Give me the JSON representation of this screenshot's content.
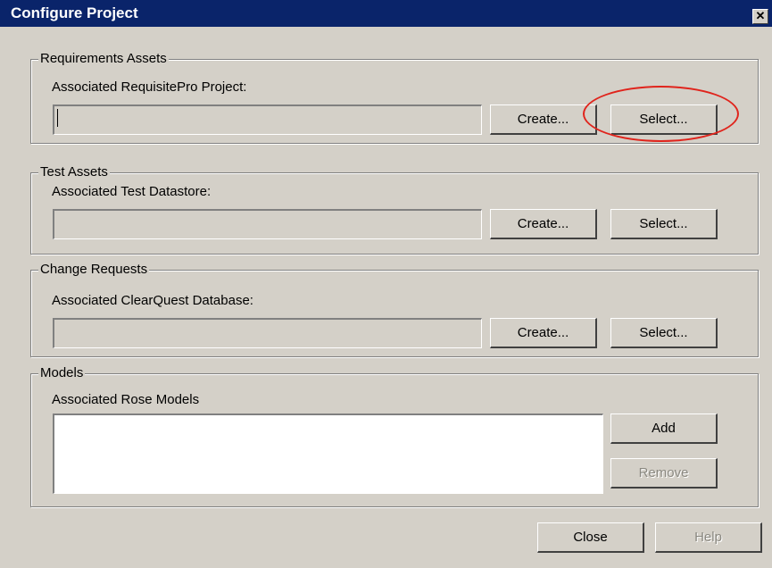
{
  "window": {
    "title": "Configure Project",
    "close_glyph": "✕"
  },
  "groups": {
    "requirements": {
      "title": "Requirements Assets",
      "label": "Associated RequisitePro Project:",
      "value": "",
      "create_label": "Create...",
      "select_label": "Select..."
    },
    "test": {
      "title": "Test Assets",
      "label": "Associated Test Datastore:",
      "value": "",
      "create_label": "Create...",
      "select_label": "Select..."
    },
    "change": {
      "title": "Change Requests",
      "label": "Associated ClearQuest Database:",
      "value": "",
      "create_label": "Create...",
      "select_label": "Select..."
    },
    "models": {
      "title": "Models",
      "label": "Associated Rose Models",
      "items": [],
      "add_label": "Add",
      "remove_label": "Remove"
    }
  },
  "footer": {
    "close_label": "Close",
    "help_label": "Help"
  },
  "colors": {
    "titlebar": "#0a246a",
    "dialog_bg": "#d4d0c8",
    "annotation": "#e0241c"
  }
}
